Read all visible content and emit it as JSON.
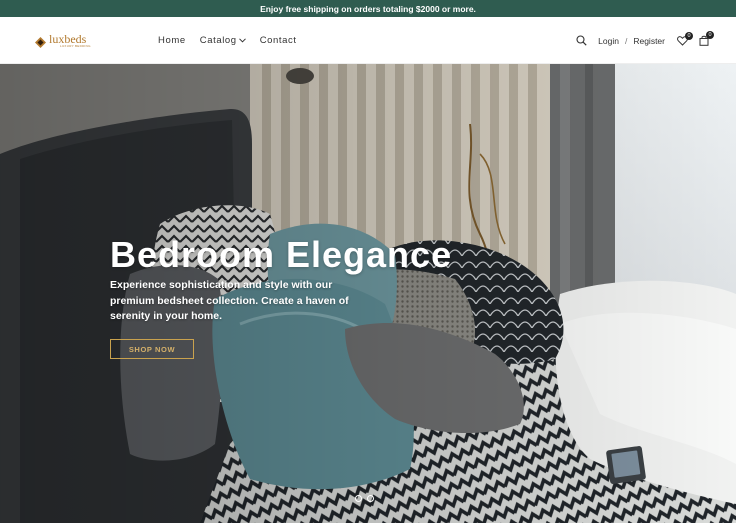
{
  "announcement": "Enjoy free shipping on orders totaling $2000 or more.",
  "brand": {
    "name": "luxbeds",
    "tagline": "LUXURY BEDDING"
  },
  "nav": {
    "home": "Home",
    "catalog": "Catalog",
    "contact": "Contact"
  },
  "account": {
    "login": "Login",
    "separator": "/",
    "register": "Register"
  },
  "wishlist_count": "0",
  "cart_count": "0",
  "hero": {
    "title": "Bedroom Elegance",
    "description": "Experience sophistication and style with our premium bedsheet collection. Create a haven of serenity in your home.",
    "button": "SHOP NOW",
    "slides": 2
  },
  "colors": {
    "announce_bg": "#2f5c50",
    "brand": "#b27a2f",
    "button_border": "#c9a24e"
  }
}
